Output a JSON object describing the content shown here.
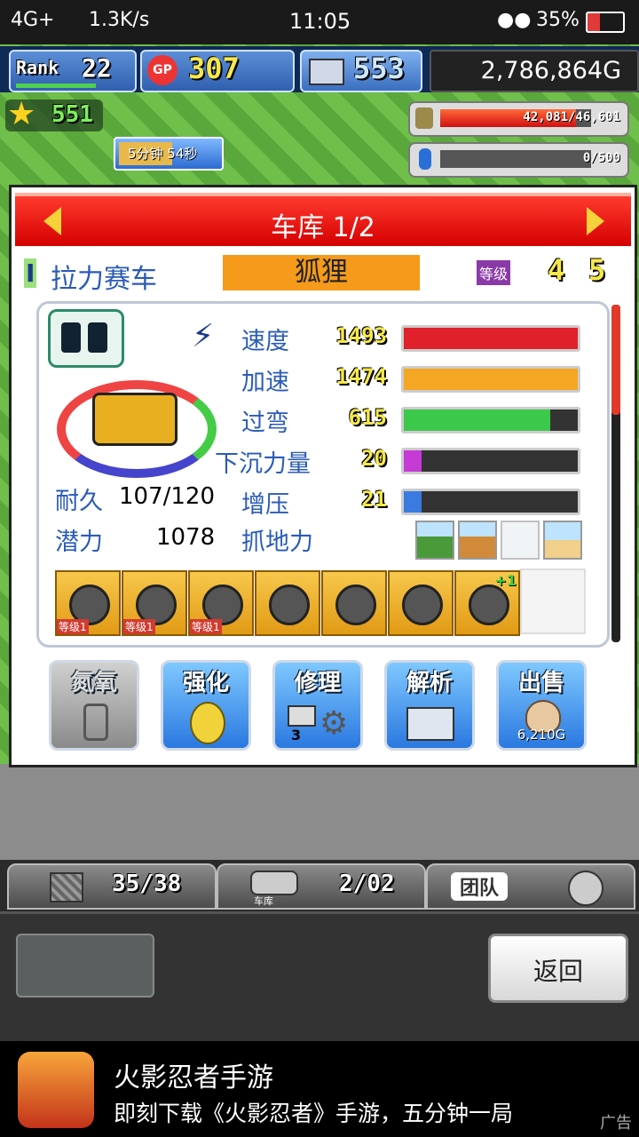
{
  "status_bar": {
    "network": "4G+",
    "speed": "1.3K/s",
    "time": "11:05",
    "battery": "35%"
  },
  "hud": {
    "rank_label": "Rank",
    "rank_value": "22",
    "gp_label": "GP",
    "gp_value": "307",
    "pc_value": "553",
    "gold": "2,786,864G",
    "star_value": "551"
  },
  "gauges": {
    "fuel": "42,081/46,601",
    "fuel_fraction": 0.9,
    "water": "0/500"
  },
  "timer": "5分钟 54秒",
  "dialog": {
    "title": "车库 1/2",
    "car_rank": "I",
    "car_type": "拉力赛车",
    "car_name": "狐狸",
    "level_label": "等级",
    "level_a": "4",
    "level_b": "5",
    "stats": [
      {
        "label": "速度",
        "value": "1493",
        "fraction": 1.0,
        "color": "#e0202a"
      },
      {
        "label": "加速",
        "value": "1474",
        "fraction": 1.0,
        "color": "#f5a623"
      },
      {
        "label": "过弯",
        "value": "615",
        "fraction": 0.84,
        "color": "#3cc84a"
      },
      {
        "label": "下沉力量",
        "value": "20",
        "fraction": 0.1,
        "color": "#c63ad6"
      },
      {
        "label": "增压",
        "value": "21",
        "fraction": 0.1,
        "color": "#3a7be0"
      }
    ],
    "durability_label": "耐久",
    "durability_value": "107/120",
    "potential_label": "潜力",
    "potential_value": "1078",
    "grip_label": "抓地力",
    "part_level_label": "等级",
    "parts": [
      {
        "icon": "engine-part-icon",
        "level": "1"
      },
      {
        "icon": "tire-part-icon",
        "level": "1"
      },
      {
        "icon": "brake-part-icon",
        "level": "1"
      },
      {
        "icon": "muffler-part-icon",
        "level": ""
      },
      {
        "icon": "chain-part-icon",
        "level": ""
      },
      {
        "icon": "oil-part-icon",
        "level": ""
      },
      {
        "icon": "frame-part-icon",
        "level": "+1"
      }
    ],
    "buttons": {
      "nitro": "氮氧",
      "upgrade": "强化",
      "repair": "修理",
      "repair_count": "3",
      "analyze": "解析",
      "sell": "出售",
      "sell_price": "6,210G"
    }
  },
  "tabs": {
    "slots": "35/38",
    "garage_label": "车库",
    "garage_count": "2/02",
    "team": "团队"
  },
  "back_button": "返回",
  "ad": {
    "title": "火影忍者手游",
    "subtitle": "即刻下载《火影忍者》手游，五分钟一局",
    "tag": "广告"
  }
}
